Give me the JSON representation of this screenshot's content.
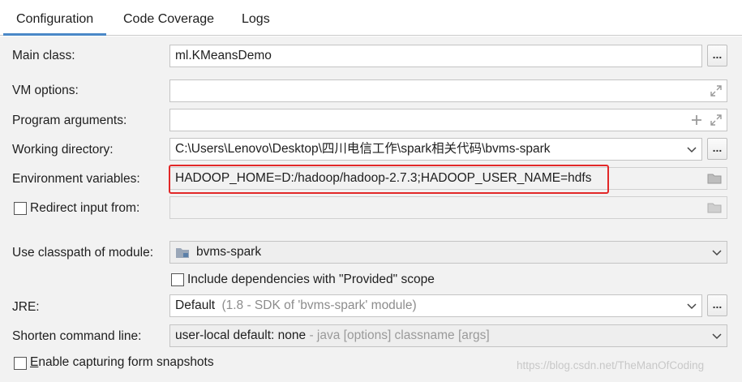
{
  "tabs": [
    {
      "label": "Configuration",
      "active": true
    },
    {
      "label": "Code Coverage",
      "active": false
    },
    {
      "label": "Logs",
      "active": false
    }
  ],
  "form": {
    "main_class": {
      "label": "Main class:",
      "value": "ml.KMeansDemo",
      "button": "..."
    },
    "vm_options": {
      "label": "VM options:",
      "value": ""
    },
    "program_arguments": {
      "label": "Program arguments:",
      "value": ""
    },
    "working_directory": {
      "label": "Working directory:",
      "value": "C:\\Users\\Lenovo\\Desktop\\四川电信工作\\spark相关代码\\bvms-spark",
      "button": "..."
    },
    "environment_variables": {
      "label": "Environment variables:",
      "value": "HADOOP_HOME=D:/hadoop/hadoop-2.7.3;HADOOP_USER_NAME=hdfs"
    },
    "redirect_input": {
      "label": "Redirect input from:",
      "checked": false,
      "value": ""
    },
    "classpath_module": {
      "label": "Use classpath of module:",
      "value": "bvms-spark"
    },
    "include_provided": {
      "label": "Include dependencies with \"Provided\" scope",
      "checked": false
    },
    "jre": {
      "label": "JRE:",
      "value": "Default",
      "hint": "(1.8 - SDK of 'bvms-spark' module)",
      "button": "..."
    },
    "shorten_command_line": {
      "label": "Shorten command line:",
      "value": "user-local default: none",
      "hint": " - java [options] classname [args]"
    },
    "capture_snapshots": {
      "label_prefix": "E",
      "label_rest": "nable capturing form snapshots",
      "checked": false
    }
  },
  "watermark": "https://blog.csdn.net/TheManOfCoding",
  "colors": {
    "active_tab_underline": "#4a88c7",
    "highlight_border": "#e22828",
    "panel_background": "#f2f2f2"
  },
  "icons": [
    "expand-icon",
    "plus-icon",
    "folder-icon",
    "chevron-down-icon",
    "module-folder-icon"
  ]
}
